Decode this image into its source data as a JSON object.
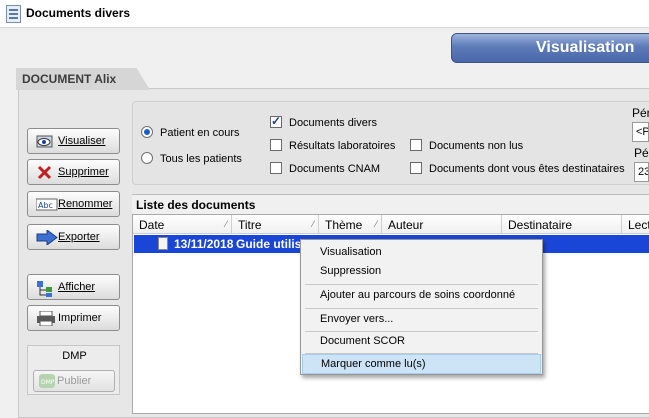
{
  "window": {
    "title": "Documents divers",
    "app_icon": "clm-app-icon"
  },
  "header": {
    "view_button": "Visualisation"
  },
  "document_tab": {
    "label": "DOCUMENT Alix"
  },
  "left_buttons": [
    {
      "label": "Visualiser",
      "icon": "eye-icon"
    },
    {
      "label": "Supprimer",
      "icon": "delete-x-icon"
    },
    {
      "label": "Renommer",
      "icon": "abc-rename-icon"
    },
    {
      "label": "Exporter",
      "icon": "arrow-right-icon"
    },
    {
      "label": "Afficher",
      "icon": "display-tree-icon"
    },
    {
      "label": "Imprimer",
      "icon": "printer-icon"
    }
  ],
  "dmp": {
    "title": "DMP",
    "publish_label": "Publier"
  },
  "filters": {
    "radios": [
      {
        "label": "Patient en cours",
        "selected": true
      },
      {
        "label": "Tous les patients",
        "selected": false
      }
    ],
    "checkboxes_col1": [
      {
        "label": "Documents divers",
        "checked": true
      },
      {
        "label": "Résultats laboratoires",
        "checked": false
      },
      {
        "label": "Documents CNAM",
        "checked": false
      }
    ],
    "checkboxes_col2": [
      {
        "label": "Documents non lus",
        "checked": false
      },
      {
        "label": "Documents dont vous êtes destinataires",
        "checked": false
      }
    ],
    "side": {
      "label_top": "Pér",
      "input_top": "<P",
      "label_bottom": "Pé",
      "input_bottom": "23"
    }
  },
  "list": {
    "title": "Liste des documents",
    "columns": [
      "Date",
      "Titre",
      "Thème",
      "Auteur",
      "Destinataire",
      "Lect"
    ],
    "rows": [
      {
        "date": "13/11/2018",
        "titre": "Guide utilisateur"
      }
    ]
  },
  "context_menu": {
    "items": [
      "Visualisation",
      "Suppression",
      "Ajouter au parcours de soins coordonné",
      "Envoyer vers...",
      "Document SCOR",
      "Marquer comme lu(s)"
    ],
    "highlighted": "Marquer comme lu(s)"
  },
  "colors": {
    "selection": "#1a46d8",
    "menu_highlight": "#cde4f7",
    "header_button": "#5d7bb8"
  }
}
